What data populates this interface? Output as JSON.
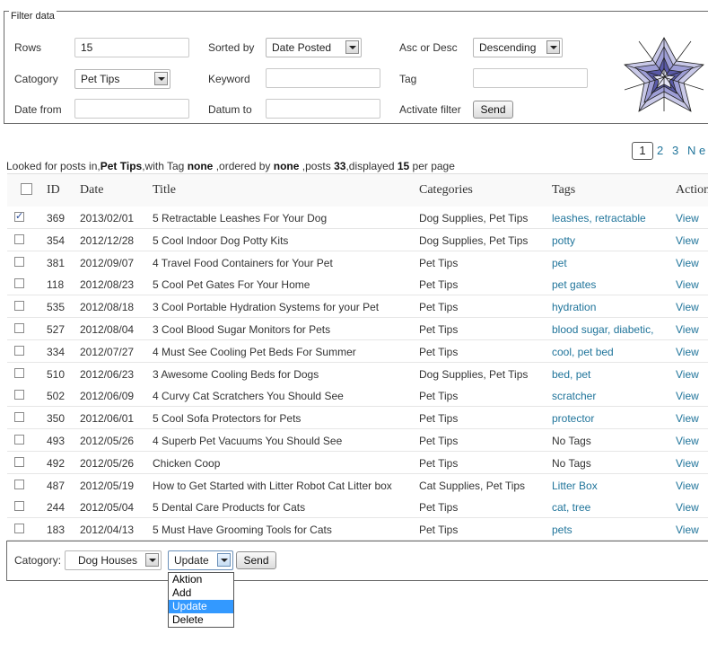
{
  "filter": {
    "legend": "Filter data",
    "rows_label": "Rows",
    "rows_value": "15",
    "sorted_by_label": "Sorted by",
    "sorted_by_value": "Date Posted",
    "order_label": "Asc or Desc",
    "order_value": "Descending",
    "category_label": "Catogory",
    "category_value": "Pet Tips",
    "keyword_label": "Keyword",
    "keyword_value": "",
    "tag_label": "Tag",
    "tag_value": "",
    "date_from_label": "Date from",
    "date_from_value": "",
    "date_to_label": "Datum to",
    "date_to_value": "",
    "activate_label": "Activate filter",
    "send_label": "Send"
  },
  "pager": {
    "current": "1",
    "pages": [
      "2",
      "3"
    ],
    "next": "N e"
  },
  "info": {
    "prefix": "Looked for posts in,",
    "category": "Pet Tips",
    "tag_text": ",with Tag ",
    "tag": "none",
    "ordered_text": " ,ordered by ",
    "ordered": "none",
    "posts_text": " ,posts ",
    "posts": "33",
    "displayed_text": ",displayed ",
    "displayed": "15",
    "suffix": " per page"
  },
  "table": {
    "headers": {
      "id": "ID",
      "date": "Date",
      "title": "Title",
      "categories": "Categories",
      "tags": "Tags",
      "actions": "Actions"
    },
    "rows": [
      {
        "checked": true,
        "id": "369",
        "date": "2013/02/01",
        "title": "5 Retractable Leashes For Your Dog",
        "categories": "Dog Supplies, Pet Tips",
        "tags": "leashes, retractable",
        "tags_link": true,
        "action": "View"
      },
      {
        "checked": false,
        "id": "354",
        "date": "2012/12/28",
        "title": "5 Cool Indoor Dog Potty Kits",
        "categories": "Dog Supplies, Pet Tips",
        "tags": "potty",
        "tags_link": true,
        "action": "View"
      },
      {
        "checked": false,
        "id": "381",
        "date": "2012/09/07",
        "title": "4 Travel Food Containers for Your Pet",
        "categories": "Pet Tips",
        "tags": "pet",
        "tags_link": true,
        "action": "View"
      },
      {
        "checked": false,
        "id": "118",
        "date": "2012/08/23",
        "title": "5 Cool Pet Gates For Your Home",
        "categories": "Pet Tips",
        "tags": "pet gates",
        "tags_link": true,
        "action": "View"
      },
      {
        "checked": false,
        "id": "535",
        "date": "2012/08/18",
        "title": "3 Cool Portable Hydration Systems for your Pet",
        "categories": "Pet Tips",
        "tags": "hydration",
        "tags_link": true,
        "action": "View"
      },
      {
        "checked": false,
        "id": "527",
        "date": "2012/08/04",
        "title": "3 Cool Blood Sugar Monitors for Pets",
        "categories": "Pet Tips",
        "tags": "blood sugar, diabetic,",
        "tags_link": true,
        "action": "View"
      },
      {
        "checked": false,
        "id": "334",
        "date": "2012/07/27",
        "title": "4 Must See Cooling Pet Beds For Summer",
        "categories": "Pet Tips",
        "tags": "cool, pet bed",
        "tags_link": true,
        "action": "View"
      },
      {
        "checked": false,
        "id": "510",
        "date": "2012/06/23",
        "title": "3 Awesome Cooling Beds for Dogs",
        "categories": "Dog Supplies, Pet Tips",
        "tags": "bed, pet",
        "tags_link": true,
        "action": "View"
      },
      {
        "checked": false,
        "id": "502",
        "date": "2012/06/09",
        "title": "4 Curvy Cat Scratchers You Should See",
        "categories": "Pet Tips",
        "tags": "scratcher",
        "tags_link": true,
        "action": "View"
      },
      {
        "checked": false,
        "id": "350",
        "date": "2012/06/01",
        "title": "5 Cool Sofa Protectors for Pets",
        "categories": "Pet Tips",
        "tags": "protector",
        "tags_link": true,
        "action": "View"
      },
      {
        "checked": false,
        "id": "493",
        "date": "2012/05/26",
        "title": "4 Superb Pet Vacuums You Should See",
        "categories": "Pet Tips",
        "tags": "No Tags",
        "tags_link": false,
        "action": "View"
      },
      {
        "checked": false,
        "id": "492",
        "date": "2012/05/26",
        "title": "Chicken Coop",
        "categories": "Pet Tips",
        "tags": "No Tags",
        "tags_link": false,
        "action": "View"
      },
      {
        "checked": false,
        "id": "487",
        "date": "2012/05/19",
        "title": "How to Get Started with Litter Robot Cat Litter box",
        "categories": "Cat Supplies, Pet Tips",
        "tags": "Litter Box",
        "tags_link": true,
        "action": "View"
      },
      {
        "checked": false,
        "id": "244",
        "date": "2012/05/04",
        "title": "5 Dental Care Products for Cats",
        "categories": "Pet Tips",
        "tags": "cat, tree",
        "tags_link": true,
        "action": "View"
      },
      {
        "checked": false,
        "id": "183",
        "date": "2012/04/13",
        "title": "5 Must Have Grooming Tools for Cats",
        "categories": "Pet Tips",
        "tags": "pets",
        "tags_link": true,
        "action": "View"
      }
    ]
  },
  "bulk": {
    "category_label": "Catogory:",
    "category_value": "Dog Houses",
    "action_value": "Update",
    "send_label": "Send",
    "options": [
      "Aktion",
      "Add",
      "Update",
      "Delete"
    ],
    "selected_option_index": 2
  },
  "colors": {
    "link": "#21759b",
    "selected_option": "#3399ff",
    "logo": "#5a5aa8"
  }
}
